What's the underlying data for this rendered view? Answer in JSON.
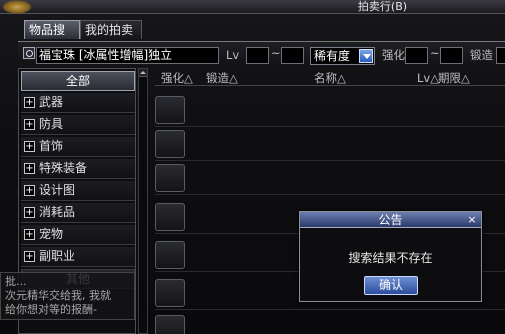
{
  "window": {
    "title": "拍卖行(B)"
  },
  "tabs": [
    {
      "label": "物品搜索"
    },
    {
      "label": "我的拍卖品"
    }
  ],
  "search": {
    "name_value": "福宝珠 [冰属性增幅]独立",
    "lv_label": "Lv",
    "lv_min": "",
    "lv_sep": "~",
    "lv_max": "",
    "sort_value": "稀有度",
    "enhance_label": "强化",
    "enhance_min": "",
    "enhance_sep": "~",
    "enhance_max": "",
    "forge_label": "锻造"
  },
  "categories": [
    {
      "label": "全部",
      "selected": true
    },
    {
      "label": "武器"
    },
    {
      "label": "防具"
    },
    {
      "label": "首饰"
    },
    {
      "label": "特殊装备"
    },
    {
      "label": "设计图"
    },
    {
      "label": "消耗品"
    },
    {
      "label": "宠物"
    },
    {
      "label": "副职业"
    },
    {
      "label": "其他"
    }
  ],
  "columns": [
    {
      "label": "强化△"
    },
    {
      "label": "锻造△"
    },
    {
      "label": "名称△"
    },
    {
      "label": "Lv△"
    },
    {
      "label": "期限△"
    }
  ],
  "hint": {
    "line1": "批...",
    "line2": "次元精华交给我, 我就",
    "line3": "给你想对等的报酬-"
  },
  "modal": {
    "title": "公告",
    "close": "×",
    "message": "搜索结果不存在",
    "ok_label": "确认"
  }
}
